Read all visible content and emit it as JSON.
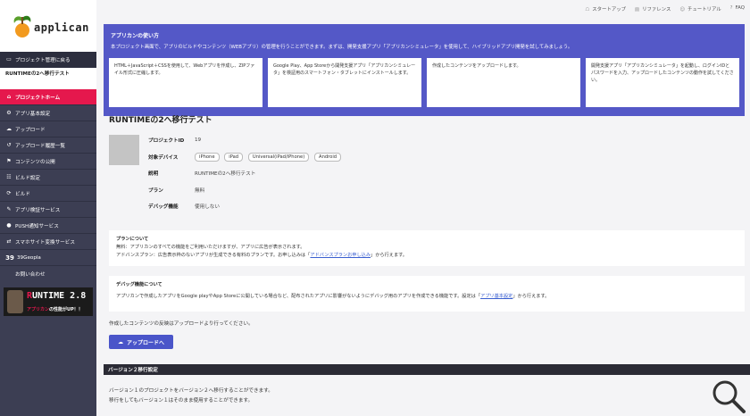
{
  "brand": {
    "name": "applican"
  },
  "sidebar": {
    "back_label": "プロジェクト管理に戻る",
    "project_name": "RUNTIMEの2へ移行テスト",
    "items": [
      {
        "label": "プロジェクトホーム",
        "icon": "home-icon"
      },
      {
        "label": "アプリ基本設定",
        "icon": "gear-icon"
      },
      {
        "label": "アップロード",
        "icon": "cloud-upload-icon"
      },
      {
        "label": "アップロード履歴一覧",
        "icon": "history-icon"
      },
      {
        "label": "コンテンツの公開",
        "icon": "flag-icon"
      },
      {
        "label": "ビルド設定",
        "icon": "settings-icon"
      },
      {
        "label": "ビルド",
        "icon": "refresh-icon"
      },
      {
        "label": "アプリ検証サービス",
        "icon": "wrench-icon"
      },
      {
        "label": "PUSH通知サービス",
        "icon": "chat-icon"
      },
      {
        "label": "スマホサイト変換サービス",
        "icon": "convert-icon"
      },
      {
        "label": "39Geopla",
        "icon": "39-icon"
      },
      {
        "label": "お問い合わせ",
        "icon": ""
      }
    ],
    "banner": {
      "title_pre": "R",
      "title_rest": "UNTIME 2.8",
      "sub_red": "アプリカン",
      "sub_white": "の性能がUP！！"
    }
  },
  "toplinks": [
    {
      "label": "スタートアップ",
      "icon": "startup-icon"
    },
    {
      "label": "リファレンス",
      "icon": "book-icon"
    },
    {
      "label": "チュートリアル",
      "icon": "tutorial-icon"
    },
    {
      "label": "FAQ",
      "icon": "faq-icon"
    }
  ],
  "guide": {
    "title": "アプリカンの使い方",
    "desc": "本プロジェクト画面で、アプリのビルドやコンテンツ（WEBアプリ）の管理を行うことができます。まずは、開発支援アプリ「アプリカンシミュレータ」を使用して、ハイブリッドアプリ開発を試してみましょう。",
    "steps": [
      "HTML＋JavaScript＋CSSを使用して、Webアプリを作成し、ZIPファイル形式に圧縮します。",
      "Google Play、App Storeから開発支援アプリ「アプリカンシミュレータ」を検証用のスマートフォン・タブレットにインストールします。",
      "作成したコンテンツをアップロードします。",
      "開発支援アプリ「アプリカンシミュレータ」を起動し、ログインIDとパスワードを入力、アップロードしたコンテンツの動作を試してください。"
    ]
  },
  "project": {
    "title": "RUNTIMEの2へ移行テスト",
    "id_label": "プロジェクトID",
    "id_value": "19",
    "devices_label": "対象デバイス",
    "devices": [
      "iPhone",
      "iPad",
      "Universal(iPad/iPhone)",
      "Android"
    ],
    "desc_label": "説明",
    "desc_value": "RUNTIMEの2へ移行テスト",
    "plan_label": "プラン",
    "plan_value": "無料",
    "debug_label": "デバッグ機能",
    "debug_value": "使用しない"
  },
  "plan_note": {
    "title": "プランについて",
    "line1": "無料：アプリカンのすべての機能をご利用いただけますが、アプリに広告が表示されます。",
    "line2_pre": "アドバンスプラン：広告表示枠のないアプリが生成できる有料のプランです。お申し込みは「",
    "line2_link": "アドバンスプランお申し込み",
    "line2_post": "」から行えます。"
  },
  "debug_note": {
    "title": "デバッグ機能について",
    "text_pre": "アプリカンで作成したアプリをGoogle playやApp Storeに公開している場合など、配布されたアプリに影響がないようにデバッグ用のアプリを作成できる機能です。設定は「",
    "text_link": "アプリ基本設定",
    "text_post": "」から行えます。"
  },
  "reflect_text": "作成したコンテンツの反映はアップロードより行ってください。",
  "upload_button": "アップロードへ",
  "v2": {
    "bar_title": "バージョン２移行設定",
    "line1": "バージョン１のプロジェクトをバージョン２へ移行することができます。",
    "line2": "移行をしてもバージョン１はそのまま使用することができます。"
  }
}
